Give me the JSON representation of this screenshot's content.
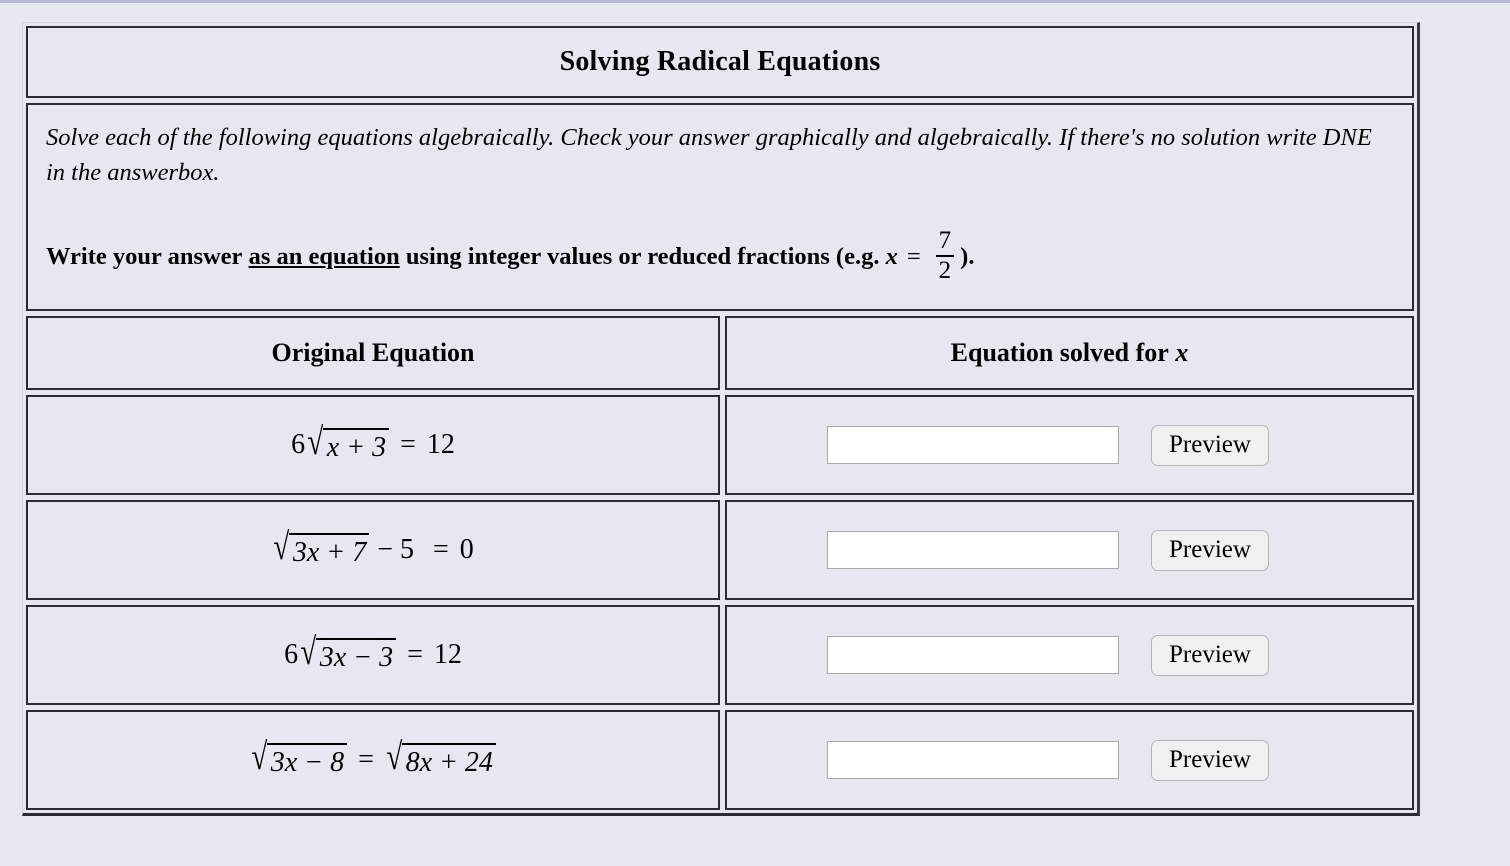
{
  "worksheet": {
    "title": "Solving Radical Equations",
    "instructions": {
      "italic": "Solve each of the following equations algebraically. Check your answer graphically and algebraically. If there's no solution write DNE in the answerbox.",
      "bold_part1": "Write your answer",
      "bold_underlined": "as an equation",
      "bold_part2": "using integer values or reduced fractions (e.g.",
      "bold_var": "x",
      "bold_equals": "=",
      "fraction_numerator": "7",
      "fraction_denominator": "2",
      "bold_part3": ")."
    },
    "table": {
      "headers": {
        "left": "Original Equation",
        "right_text": "Equation solved for",
        "right_var": "x"
      },
      "rows": [
        {
          "equation": {
            "coefficient": "6",
            "radicand": "x + 3",
            "relation": "=",
            "rhs": "12",
            "plain": "6√(x + 3) = 12"
          },
          "answer_value": "",
          "answer_placeholder": "",
          "preview_label": "Preview"
        },
        {
          "equation": {
            "coefficient": "",
            "radicand": "3x + 7",
            "tail": "− 5",
            "relation": "=",
            "rhs": "0",
            "plain": "√(3x + 7) − 5 = 0"
          },
          "answer_value": "",
          "answer_placeholder": "",
          "preview_label": "Preview"
        },
        {
          "equation": {
            "coefficient": "6",
            "radicand": "3x − 3",
            "relation": "=",
            "rhs": "12",
            "plain": "6√(3x − 3) = 12"
          },
          "answer_value": "",
          "answer_placeholder": "",
          "preview_label": "Preview"
        },
        {
          "equation": {
            "coefficient": "",
            "radicand": "3x − 8",
            "relation": "=",
            "rhs_radicand": "8x + 24",
            "plain": "√(3x − 8) = √(8x + 24)"
          },
          "answer_value": "",
          "answer_placeholder": "",
          "preview_label": "Preview"
        }
      ]
    }
  },
  "colors": {
    "page_background": "#e8e7f1",
    "cell_border": "#2b2b33",
    "frame_border": "#d6d6dc",
    "input_background": "#ffffff",
    "button_background": "#f0f0f0",
    "top_rule": "#b7bdd8"
  }
}
